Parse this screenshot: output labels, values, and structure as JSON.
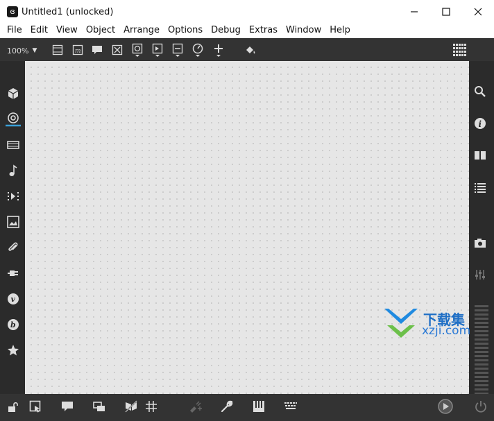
{
  "window": {
    "title": "Untitled1 (unlocked)"
  },
  "menu": [
    "File",
    "Edit",
    "View",
    "Object",
    "Arrange",
    "Options",
    "Debug",
    "Extras",
    "Window",
    "Help"
  ],
  "toolbar": {
    "zoom": "100%"
  },
  "watermark": {
    "top": "下载集",
    "bottom": "xzji.com"
  },
  "colors": {
    "chrome": "#333333",
    "canvas": "#e6e6e6",
    "accent": "#3a9fd8"
  }
}
